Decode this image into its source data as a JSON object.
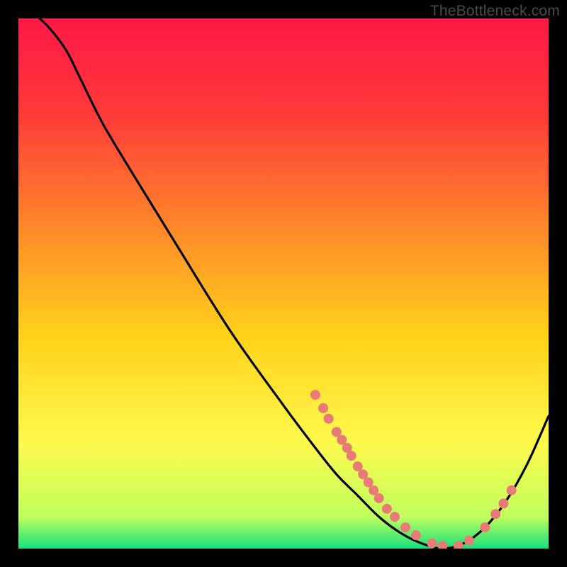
{
  "watermark": "TheBottleneck.com",
  "chart_data": {
    "type": "line",
    "title": "",
    "xlabel": "",
    "ylabel": "",
    "xlim": [
      0,
      100
    ],
    "ylim": [
      0,
      100
    ],
    "grid": false,
    "legend": false,
    "background_gradient": {
      "stops": [
        {
          "offset": 0.0,
          "color": "#ff1846"
        },
        {
          "offset": 0.18,
          "color": "#ff3a3a"
        },
        {
          "offset": 0.4,
          "color": "#ff8a2a"
        },
        {
          "offset": 0.6,
          "color": "#ffd21a"
        },
        {
          "offset": 0.8,
          "color": "#fff94d"
        },
        {
          "offset": 0.94,
          "color": "#c0ff5e"
        },
        {
          "offset": 1.0,
          "color": "#18e07a"
        }
      ]
    },
    "series": [
      {
        "name": "bottleneck-curve",
        "x": [
          4,
          6,
          9,
          12,
          16,
          22,
          30,
          40,
          50,
          56,
          60,
          64,
          68,
          72,
          76,
          80,
          84,
          88,
          92,
          96,
          100
        ],
        "y": [
          100,
          98,
          94,
          88,
          80,
          70,
          57,
          41,
          27,
          19,
          14,
          10,
          6,
          3,
          1,
          0,
          1,
          4,
          9,
          16,
          25
        ]
      }
    ],
    "markers": [
      {
        "x": 56,
        "y": 29
      },
      {
        "x": 57.5,
        "y": 26.5
      },
      {
        "x": 58.5,
        "y": 24.5
      },
      {
        "x": 60,
        "y": 22
      },
      {
        "x": 61,
        "y": 20.5
      },
      {
        "x": 62,
        "y": 19
      },
      {
        "x": 62.8,
        "y": 17.5
      },
      {
        "x": 64,
        "y": 15.5
      },
      {
        "x": 65,
        "y": 14
      },
      {
        "x": 66,
        "y": 12.5
      },
      {
        "x": 67,
        "y": 11
      },
      {
        "x": 68,
        "y": 9.5
      },
      {
        "x": 69.5,
        "y": 7.5
      },
      {
        "x": 71,
        "y": 6
      },
      {
        "x": 73,
        "y": 4
      },
      {
        "x": 75,
        "y": 2.5
      },
      {
        "x": 78,
        "y": 1
      },
      {
        "x": 80,
        "y": 0.5
      },
      {
        "x": 83,
        "y": 0.5
      },
      {
        "x": 85,
        "y": 1.5
      },
      {
        "x": 88,
        "y": 4
      },
      {
        "x": 90,
        "y": 6.5
      },
      {
        "x": 91.5,
        "y": 8.5
      },
      {
        "x": 93,
        "y": 11
      }
    ],
    "marker_style": {
      "color": "#e97b77",
      "radius": 7
    }
  }
}
